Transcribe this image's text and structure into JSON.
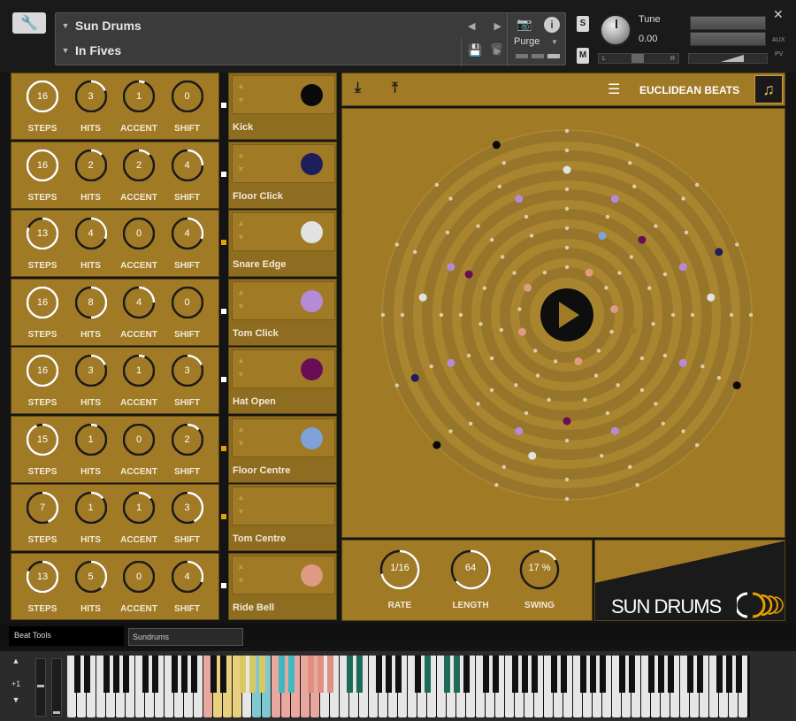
{
  "header": {
    "instrument_name": "Sun Drums",
    "preset_name": "In Fives",
    "purge_label": "Purge",
    "solo_label": "S",
    "mute_label": "M",
    "tune_label": "Tune",
    "tune_value": "0.00",
    "pan_left": "L",
    "pan_right": "R",
    "aux_label": "AUX",
    "pv_label": "PV"
  },
  "tracks": [
    {
      "steps": 16,
      "hits": 3,
      "accent": 1,
      "shift": 0,
      "sample": "Kick",
      "color": "#0a0a0a"
    },
    {
      "steps": 16,
      "hits": 2,
      "accent": 2,
      "shift": 4,
      "sample": "Floor Click",
      "color": "#1e1e5a"
    },
    {
      "steps": 13,
      "hits": 4,
      "accent": 0,
      "shift": 4,
      "sample": "Snare Edge",
      "color": "#e2e2e2"
    },
    {
      "steps": 16,
      "hits": 8,
      "accent": 4,
      "shift": 0,
      "sample": "Tom Click",
      "color": "#b58ad8"
    },
    {
      "steps": 16,
      "hits": 3,
      "accent": 1,
      "shift": 3,
      "sample": "Hat Open",
      "color": "#6a0d55"
    },
    {
      "steps": 15,
      "hits": 1,
      "accent": 0,
      "shift": 2,
      "sample": "Floor Centre",
      "color": "#7ea2d8"
    },
    {
      "steps": 7,
      "hits": 1,
      "accent": 1,
      "shift": 3,
      "sample": "Tom Centre",
      "color": "#a07a25"
    },
    {
      "steps": 13,
      "hits": 5,
      "accent": 0,
      "shift": 4,
      "sample": "Ride Bell",
      "color": "#e09a82"
    }
  ],
  "knob_labels": {
    "steps": "STEPS",
    "hits": "HITS",
    "accent": "ACCENT",
    "shift": "SHIFT"
  },
  "main": {
    "title": "EUCLIDEAN BEATS",
    "rate_value": "1/16",
    "rate_label": "RATE",
    "length_value": "64",
    "length_label": "LENGTH",
    "swing_value": "17 %",
    "swing_label": "SWING",
    "logo_text": "SUN DRUMS"
  },
  "tabs": {
    "tab1": "Beat Tools",
    "tab2": "Sundrums"
  },
  "keyboard": {
    "octave_label": "+1"
  },
  "colors": {
    "gold": "#a07a25",
    "panel_border": "#5a4514",
    "dark": "#1a1a1a"
  }
}
